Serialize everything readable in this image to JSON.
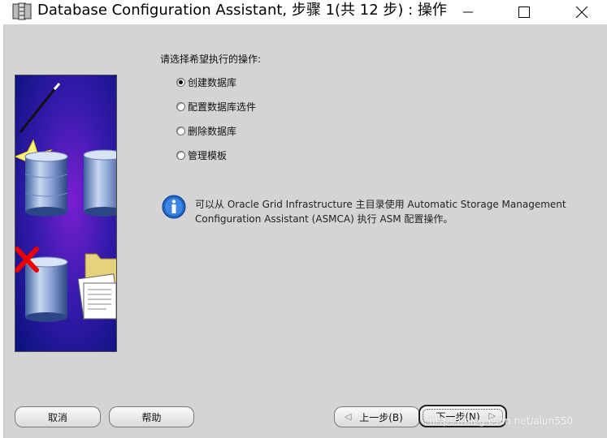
{
  "window": {
    "title": "Database Configuration Assistant, 步骤 1(共 12 步) : 操作",
    "icon": "database-app-icon",
    "controls": [
      "minimize-icon",
      "maximize-icon",
      "close-icon"
    ]
  },
  "main": {
    "prompt": "请选择希望执行的操作:",
    "options": [
      {
        "label": "创建数据库",
        "selected": true
      },
      {
        "label": "配置数据库选件",
        "selected": false
      },
      {
        "label": "删除数据库",
        "selected": false
      },
      {
        "label": "管理模板",
        "selected": false
      }
    ],
    "info": {
      "icon": "info-icon",
      "text": "可以从 Oracle Grid Infrastructure 主目录使用 Automatic Storage Management Configuration Assistant (ASMCA) 执行 ASM 配置操作。"
    }
  },
  "footer": {
    "cancel_label": "取消",
    "help_label": "帮助",
    "back_label": "上一步(B)",
    "next_label": "下一步(N)"
  },
  "watermark": "https://blog.csdn.net/alun550",
  "colors": {
    "dialog_bg": "#d4d4d4",
    "illustration_bg": "#0b1a8f",
    "info_blue": "#1e63c6"
  }
}
